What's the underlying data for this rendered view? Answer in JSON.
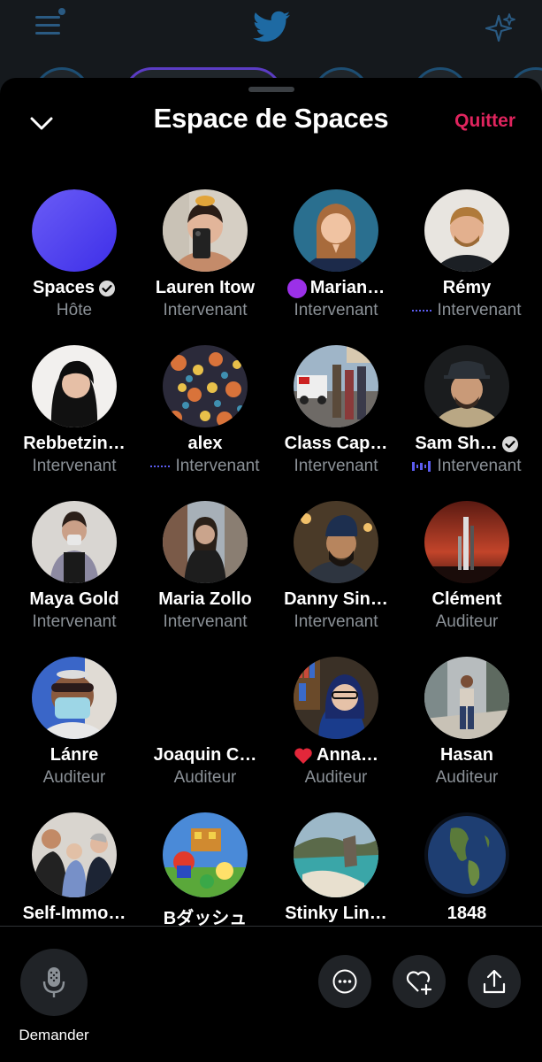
{
  "header": {
    "title": "Espace de Spaces",
    "quit_label": "Quitter"
  },
  "participants": [
    {
      "name": "Spaces",
      "role": "Hôte",
      "verified": true,
      "avatar": "purple-gradient"
    },
    {
      "name": "Lauren Itow",
      "role": "Intervenant",
      "avatar": "photo"
    },
    {
      "name": "Marian…",
      "role": "Intervenant",
      "prefix": "purple-circle-emoji",
      "avatar": "photo"
    },
    {
      "name": "Rémy",
      "role": "Intervenant",
      "role_icon": "dotted-line-icon",
      "avatar": "photo"
    },
    {
      "name": "Rebbetzin…",
      "role": "Intervenant",
      "avatar": "photo"
    },
    {
      "name": "alex",
      "role": "Intervenant",
      "role_icon": "dotted-line-icon",
      "avatar": "photo"
    },
    {
      "name": "Class Cap…",
      "role": "Intervenant",
      "avatar": "photo"
    },
    {
      "name": "Sam Sh…",
      "role": "Intervenant",
      "verified": true,
      "role_icon": "speaking-wave-icon",
      "avatar": "photo"
    },
    {
      "name": "Maya Gold",
      "role": "Intervenant",
      "avatar": "photo"
    },
    {
      "name": "Maria Zollo",
      "role": "Intervenant",
      "avatar": "photo"
    },
    {
      "name": "Danny Sin…",
      "role": "Intervenant",
      "avatar": "photo"
    },
    {
      "name": "Clément",
      "role": "Auditeur",
      "avatar": "photo"
    },
    {
      "name": "Lánre",
      "role": "Auditeur",
      "avatar": "photo"
    },
    {
      "name": "Joaquin C…",
      "role": "Auditeur",
      "avatar": "none"
    },
    {
      "name": "Anna…",
      "role": "Auditeur",
      "prefix": "red-heart-emoji",
      "avatar": "photo"
    },
    {
      "name": "Hasan",
      "role": "Auditeur",
      "avatar": "photo"
    },
    {
      "name": "Self-Immo…",
      "role": "",
      "avatar": "photo"
    },
    {
      "name": "Bダッシュ",
      "role": "",
      "avatar": "photo"
    },
    {
      "name": "Stinky Lin…",
      "role": "",
      "avatar": "photo"
    },
    {
      "name": "1848",
      "role": "",
      "avatar": "photo"
    }
  ],
  "bottom_bar": {
    "request_label": "Demander"
  },
  "colors": {
    "accent": "#1d9bf0",
    "quit": "#e0245e",
    "speaking": "#5b5cf0",
    "muted_text": "#8b9197"
  }
}
